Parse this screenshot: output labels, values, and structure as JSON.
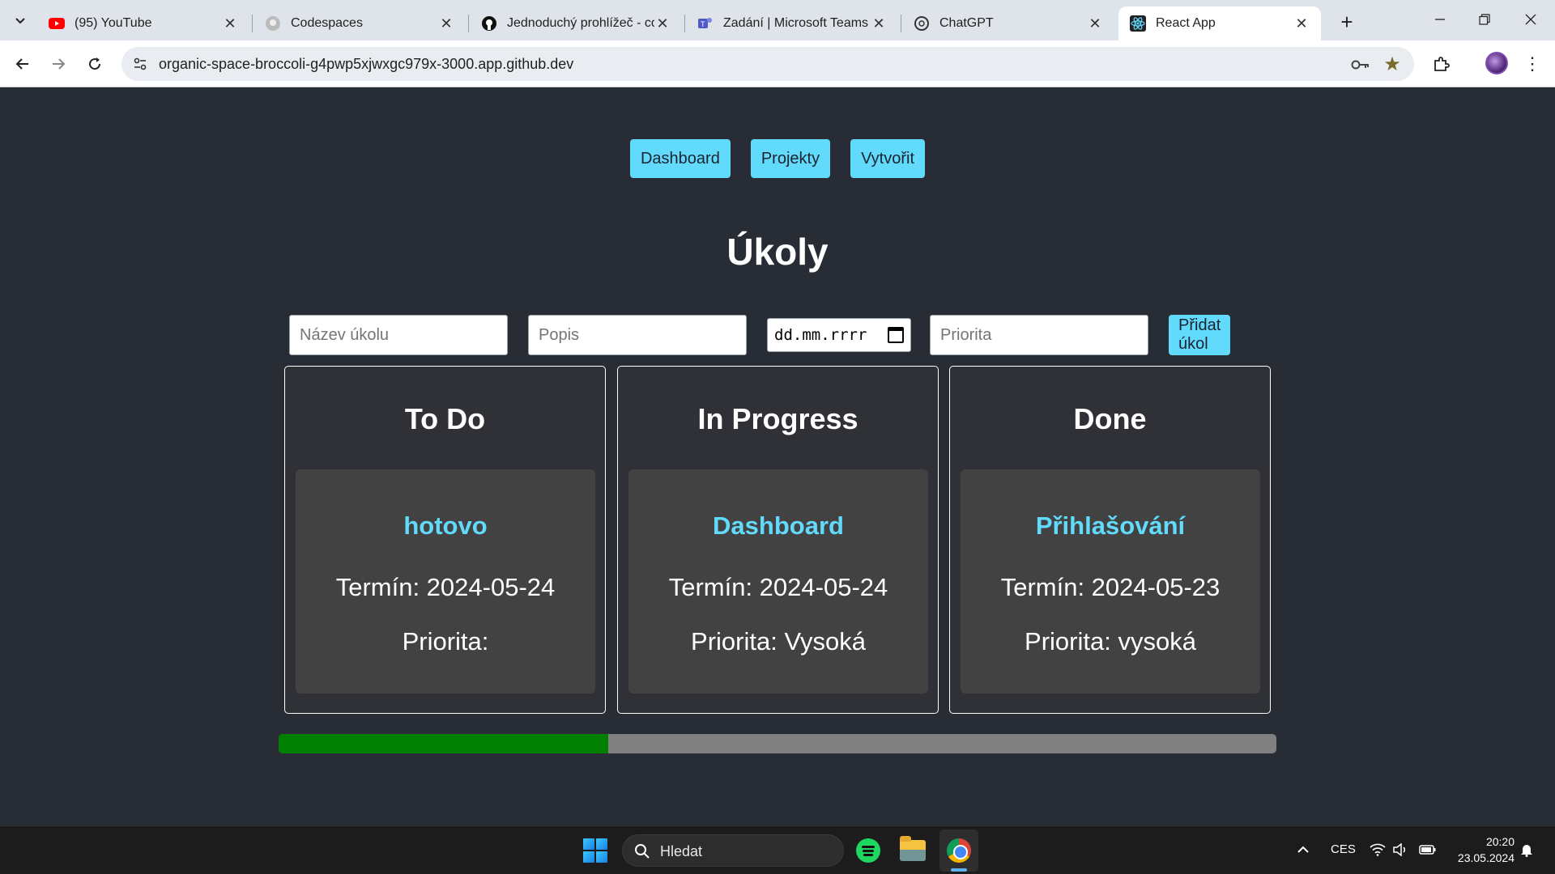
{
  "browser": {
    "tabs": [
      {
        "title": "(95) YouTube",
        "icon": "youtube-icon"
      },
      {
        "title": "Codespaces",
        "icon": "github-icon"
      },
      {
        "title": "Jednoduchý prohlížeč - co",
        "icon": "github-icon"
      },
      {
        "title": "Zadání | Microsoft Teams c",
        "icon": "teams-icon"
      },
      {
        "title": "ChatGPT",
        "icon": "chatgpt-icon"
      },
      {
        "title": "React App",
        "icon": "react-icon",
        "active": true
      }
    ],
    "url": "organic-space-broccoli-g4pwp5xjwxgc979x-3000.app.github.dev"
  },
  "app": {
    "nav": [
      "Dashboard",
      "Projekty",
      "Vytvořit"
    ],
    "title": "Úkoly",
    "form": {
      "name_placeholder": "Název úkolu",
      "description_placeholder": "Popis",
      "date_placeholder": "dd.mm.rrrr",
      "priority_placeholder": "Priorita",
      "add_button": "Přidat úkol"
    },
    "columns": [
      {
        "title": "To Do",
        "tasks": [
          {
            "name": "hotovo",
            "deadline": "Termín: 2024-05-24",
            "priority": "Priorita:"
          }
        ]
      },
      {
        "title": "In Progress",
        "tasks": [
          {
            "name": "Dashboard",
            "deadline": "Termín: 2024-05-24",
            "priority": "Priorita: Vysoká"
          }
        ]
      },
      {
        "title": "Done",
        "tasks": [
          {
            "name": "Přihlašování",
            "deadline": "Termín: 2024-05-23",
            "priority": "Priorita: vysoká"
          }
        ]
      }
    ],
    "progress_fraction": 0.33,
    "colors": {
      "accent": "#61dafb",
      "background": "#282c34",
      "progress_fill": "#008000",
      "progress_track": "#808080"
    }
  },
  "taskbar": {
    "search_label": "Hledat",
    "language": "CES",
    "time": "20:20",
    "date": "23.05.2024"
  }
}
